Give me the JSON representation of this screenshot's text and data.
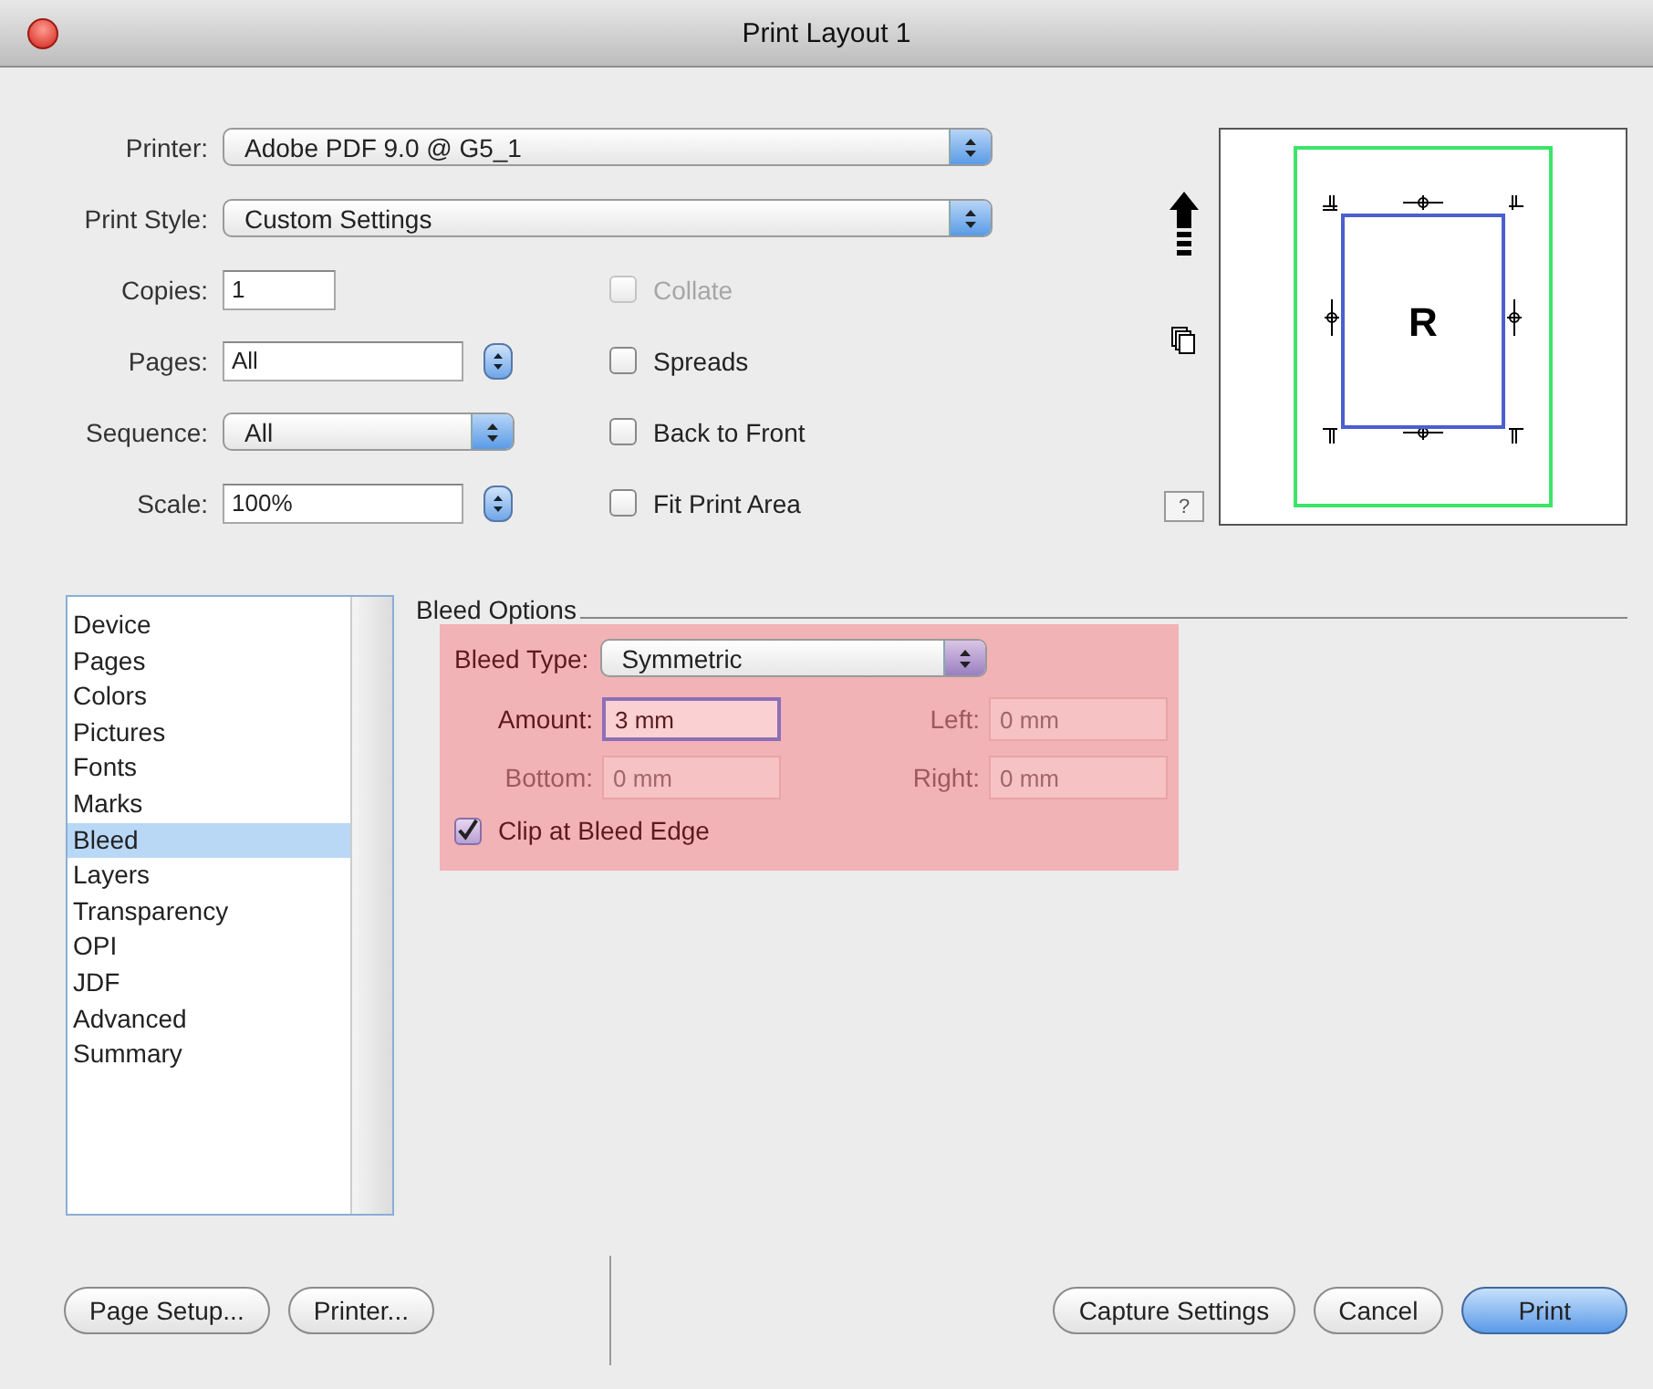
{
  "window": {
    "title": "Print Layout 1"
  },
  "settings": [
    {
      "kind": "popup",
      "label": "Printer:",
      "value": "Adobe PDF 9.0 @ G5_1"
    },
    {
      "kind": "popup",
      "label": "Print Style:",
      "value": "Custom Settings"
    },
    {
      "kind": "field",
      "label": "Copies:",
      "value": "1"
    },
    {
      "kind": "stepper-field",
      "label": "Pages:",
      "value": "All"
    },
    {
      "kind": "small-popup",
      "label": "Sequence:",
      "value": "All"
    },
    {
      "kind": "stepper-field",
      "label": "Scale:",
      "value": "100%"
    }
  ],
  "options": [
    {
      "label": "Collate",
      "checked": false,
      "disabled": true
    },
    {
      "label": "Spreads",
      "checked": false,
      "disabled": false
    },
    {
      "label": "Back to Front",
      "checked": false,
      "disabled": false
    },
    {
      "label": "Fit Print Area",
      "checked": false,
      "disabled": false
    }
  ],
  "preview": {
    "letter": "R",
    "help": "?"
  },
  "sections": [
    {
      "label": "Device",
      "selected": false
    },
    {
      "label": "Pages",
      "selected": false
    },
    {
      "label": "Colors",
      "selected": false
    },
    {
      "label": "Pictures",
      "selected": false
    },
    {
      "label": "Fonts",
      "selected": false
    },
    {
      "label": "Marks",
      "selected": false
    },
    {
      "label": "Bleed",
      "selected": true
    },
    {
      "label": "Layers",
      "selected": false
    },
    {
      "label": "Transparency",
      "selected": false
    },
    {
      "label": "OPI",
      "selected": false
    },
    {
      "label": "JDF",
      "selected": false
    },
    {
      "label": "Advanced",
      "selected": false
    },
    {
      "label": "Summary",
      "selected": false
    }
  ],
  "bleed": {
    "title": "Bleed Options",
    "type_label": "Bleed Type:",
    "type_value": "Symmetric",
    "fields": [
      {
        "label": "Amount:",
        "value": "3 mm",
        "disabled": false,
        "focused": true
      },
      {
        "label": "Left:",
        "value": "0 mm",
        "disabled": true,
        "focused": false
      },
      {
        "label": "Bottom:",
        "value": "0 mm",
        "disabled": true,
        "focused": false
      },
      {
        "label": "Right:",
        "value": "0 mm",
        "disabled": true,
        "focused": false
      }
    ],
    "clip": {
      "label": "Clip at Bleed Edge",
      "checked": true
    }
  },
  "footer": {
    "left_buttons": [
      {
        "label": "Page Setup...",
        "default": false
      },
      {
        "label": "Printer...",
        "default": false
      }
    ],
    "right_buttons": [
      {
        "label": "Capture Settings",
        "default": false
      },
      {
        "label": "Cancel",
        "default": false
      },
      {
        "label": "Print",
        "default": true
      }
    ]
  }
}
